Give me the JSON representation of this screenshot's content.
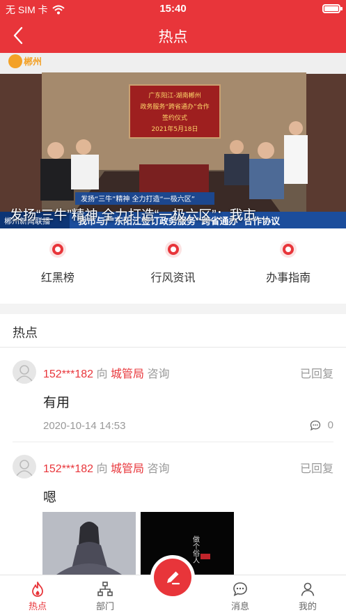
{
  "status": {
    "carrier": "无 SIM 卡",
    "time": "15:40"
  },
  "nav": {
    "title": "热点"
  },
  "banner": {
    "caption": "发扬“三牛”精神 全力打造“一极六区”：我市…",
    "logo_text": "郴州",
    "screen_lines": [
      "广东阳江-湖南郴州",
      "政务服务“跨省通办”合作",
      "签约仪式",
      "2021年5月18日"
    ],
    "ticker": "我市与广东阳江签订政务服务“跨省通办”合作协议",
    "ticker_source": "郴州新闻联播",
    "subtitle_strip": "发扬“三牛”精神 全力打造“一极六区”"
  },
  "quick": [
    {
      "label": "红黑榜",
      "icon": "star-icon"
    },
    {
      "label": "行风资讯",
      "icon": "phone-icon"
    },
    {
      "label": "办事指南",
      "icon": "compass-icon"
    }
  ],
  "section": {
    "title": "热点"
  },
  "posts": [
    {
      "user": "152***182",
      "to": "向",
      "dept": "城管局",
      "type": "咨询",
      "state": "已回复",
      "content": "有用",
      "date": "2020-10-14 14:53",
      "comments": "0"
    },
    {
      "user": "152***182",
      "to": "向",
      "dept": "城管局",
      "type": "咨询",
      "state": "已回复",
      "content": "嗯",
      "thumb2_text": "做个俗人"
    }
  ],
  "tabs": [
    {
      "label": "热点",
      "active": true
    },
    {
      "label": "部门",
      "active": false
    },
    {
      "label": "消息",
      "active": false
    },
    {
      "label": "我的",
      "active": false
    }
  ],
  "colors": {
    "primary": "#e8353a",
    "muted": "#999999"
  }
}
